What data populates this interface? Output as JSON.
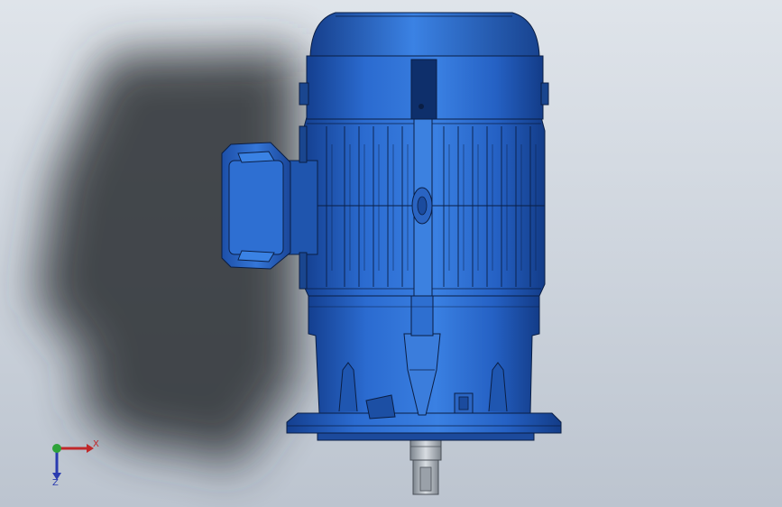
{
  "viewport": {
    "background_top": "#dfe4ea",
    "background_bottom": "#bcc4cf"
  },
  "model": {
    "body_color": "#2c6ed0",
    "body_dark": "#0e2f6b",
    "edge_color": "#0a1e44",
    "shaft_color": "#a9b0b8"
  },
  "triad": {
    "x_label": "X",
    "z_label": "Z",
    "x_color": "#c0282a",
    "y_color": "#2ea33a",
    "z_color": "#2a3bb0",
    "x_icon": "arrow-right-icon",
    "z_icon": "arrow-down-icon"
  }
}
